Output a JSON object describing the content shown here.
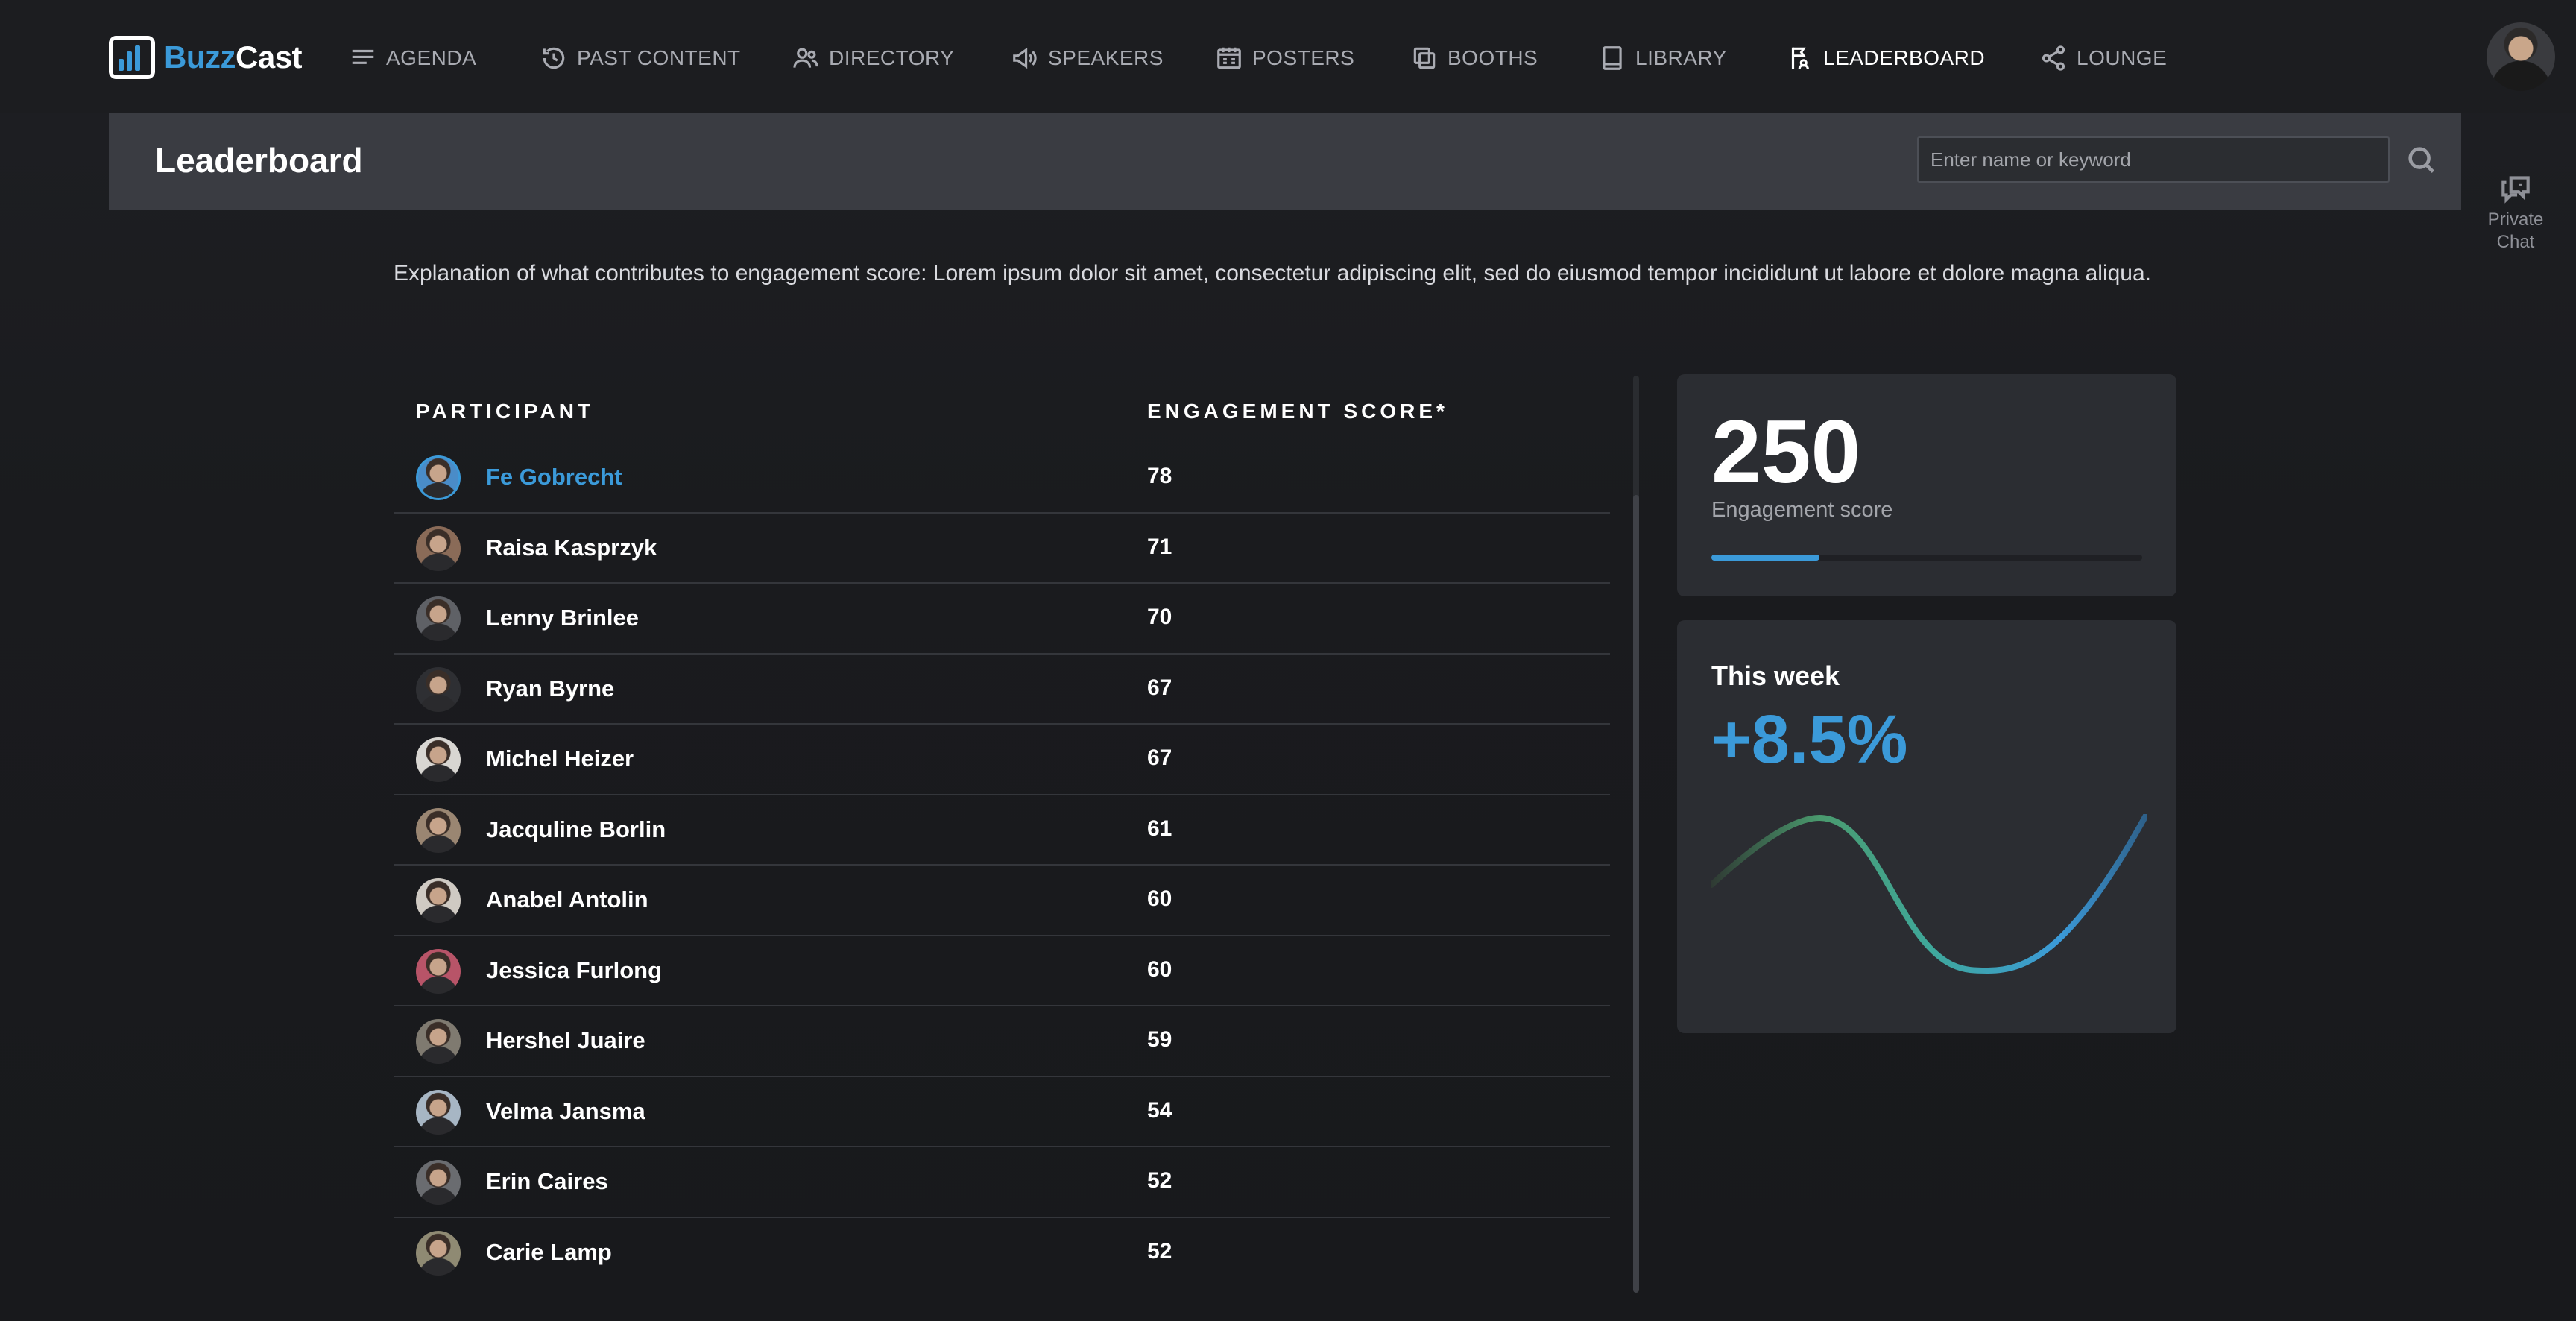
{
  "app": {
    "brand_part1": "Buzz",
    "brand_part2": "Cast",
    "accent_color": "#3b9ad9"
  },
  "nav": [
    {
      "label": "AGENDA",
      "icon": "list-icon",
      "active": false
    },
    {
      "label": "PAST CONTENT",
      "icon": "history-icon",
      "active": false
    },
    {
      "label": "DIRECTORY",
      "icon": "people-icon",
      "active": false
    },
    {
      "label": "SPEAKERS",
      "icon": "megaphone-icon",
      "active": false
    },
    {
      "label": "POSTERS",
      "icon": "poster-icon",
      "active": false
    },
    {
      "label": "BOOTHS",
      "icon": "booth-icon",
      "active": false
    },
    {
      "label": "LIBRARY",
      "icon": "book-icon",
      "active": false
    },
    {
      "label": "LEADERBOARD",
      "icon": "leaderboard-icon",
      "active": true
    },
    {
      "label": "LOUNGE",
      "icon": "share-icon",
      "active": false
    }
  ],
  "header": {
    "title": "Leaderboard",
    "search_placeholder": "Enter name or keyword"
  },
  "sidebar_right": {
    "private_chat_line1": "Private",
    "private_chat_line2": "Chat"
  },
  "description": "Explanation of what contributes to engagement score: Lorem ipsum dolor sit amet, consectetur adipiscing elit, sed do eiusmod tempor incididunt ut labore et dolore magna aliqua.",
  "table": {
    "col_participant": "PARTICIPANT",
    "col_score": "ENGAGEMENT SCORE*",
    "rows": [
      {
        "name": "Fe Gobrecht",
        "score": "78",
        "highlight": true,
        "avatar_color": "#4a8cc8"
      },
      {
        "name": "Raisa Kasprzyk",
        "score": "71",
        "highlight": false,
        "avatar_color": "#8a6b58"
      },
      {
        "name": "Lenny Brinlee",
        "score": "70",
        "highlight": false,
        "avatar_color": "#5f6166"
      },
      {
        "name": "Ryan Byrne",
        "score": "67",
        "highlight": false,
        "avatar_color": "#2e2f33"
      },
      {
        "name": "Michel Heizer",
        "score": "67",
        "highlight": false,
        "avatar_color": "#d8d6d2"
      },
      {
        "name": "Jacquline Borlin",
        "score": "61",
        "highlight": false,
        "avatar_color": "#9a8672"
      },
      {
        "name": "Anabel Antolin",
        "score": "60",
        "highlight": false,
        "avatar_color": "#cfcac3"
      },
      {
        "name": "Jessica Furlong",
        "score": "60",
        "highlight": false,
        "avatar_color": "#b85468"
      },
      {
        "name": "Hershel Juaire",
        "score": "59",
        "highlight": false,
        "avatar_color": "#7f7a70"
      },
      {
        "name": "Velma Jansma",
        "score": "54",
        "highlight": false,
        "avatar_color": "#a7b6c4"
      },
      {
        "name": "Erin Caires",
        "score": "52",
        "highlight": false,
        "avatar_color": "#6a6c70"
      },
      {
        "name": "Carie Lamp",
        "score": "52",
        "highlight": false,
        "avatar_color": "#8f8a73"
      }
    ]
  },
  "score_card": {
    "value": "250",
    "caption": "Engagement score",
    "progress_fraction": 0.25
  },
  "week_card": {
    "title": "This week",
    "value": "+8.5%"
  }
}
